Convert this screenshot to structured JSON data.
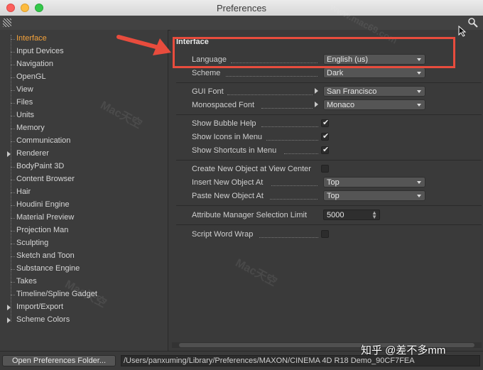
{
  "window": {
    "title": "Preferences"
  },
  "sidebar": {
    "items": [
      {
        "label": "Interface",
        "active": true,
        "expandable": false
      },
      {
        "label": "Input Devices",
        "active": false,
        "expandable": false
      },
      {
        "label": "Navigation",
        "active": false,
        "expandable": false
      },
      {
        "label": "OpenGL",
        "active": false,
        "expandable": false
      },
      {
        "label": "View",
        "active": false,
        "expandable": false
      },
      {
        "label": "Files",
        "active": false,
        "expandable": false
      },
      {
        "label": "Units",
        "active": false,
        "expandable": false
      },
      {
        "label": "Memory",
        "active": false,
        "expandable": false
      },
      {
        "label": "Communication",
        "active": false,
        "expandable": false
      },
      {
        "label": "Renderer",
        "active": false,
        "expandable": true
      },
      {
        "label": "BodyPaint 3D",
        "active": false,
        "expandable": false
      },
      {
        "label": "Content Browser",
        "active": false,
        "expandable": false
      },
      {
        "label": "Hair",
        "active": false,
        "expandable": false
      },
      {
        "label": "Houdini Engine",
        "active": false,
        "expandable": false
      },
      {
        "label": "Material Preview",
        "active": false,
        "expandable": false
      },
      {
        "label": "Projection Man",
        "active": false,
        "expandable": false
      },
      {
        "label": "Sculpting",
        "active": false,
        "expandable": false
      },
      {
        "label": "Sketch and Toon",
        "active": false,
        "expandable": false
      },
      {
        "label": "Substance Engine",
        "active": false,
        "expandable": false
      },
      {
        "label": "Takes",
        "active": false,
        "expandable": false
      },
      {
        "label": "Timeline/Spline Gadget",
        "active": false,
        "expandable": false
      },
      {
        "label": "Import/Export",
        "active": false,
        "expandable": true
      },
      {
        "label": "Scheme Colors",
        "active": false,
        "expandable": true
      }
    ]
  },
  "main": {
    "section_title": "Interface",
    "language": {
      "label": "Language",
      "value": "English (us)"
    },
    "scheme": {
      "label": "Scheme",
      "value": "Dark"
    },
    "gui_font": {
      "label": "GUI Font",
      "value": "San Francisco"
    },
    "mono_font": {
      "label": "Monospaced Font",
      "value": "Monaco"
    },
    "bubble_help": {
      "label": "Show Bubble Help",
      "checked": true
    },
    "icons_menu": {
      "label": "Show Icons in Menu",
      "checked": true
    },
    "shortcuts_menu": {
      "label": "Show Shortcuts in Menu",
      "checked": true
    },
    "create_at_center": {
      "label": "Create New Object at View Center",
      "checked": false
    },
    "insert_at": {
      "label": "Insert New Object At",
      "value": "Top"
    },
    "paste_at": {
      "label": "Paste New Object At",
      "value": "Top"
    },
    "selection_limit": {
      "label": "Attribute Manager Selection Limit",
      "value": "5000"
    },
    "word_wrap": {
      "label": "Script Word Wrap",
      "checked": false
    }
  },
  "footer": {
    "open_folder_label": "Open Preferences Folder...",
    "path": "/Users/panxuming/Library/Preferences/MAXON/CINEMA 4D R18 Demo_90CF7FEA"
  },
  "overlay": {
    "watermark_text": "Mac天空",
    "watermark_url": "www.mac69.com",
    "signature": "知乎 @差不多mm",
    "highlight_color": "#e84c3d"
  }
}
